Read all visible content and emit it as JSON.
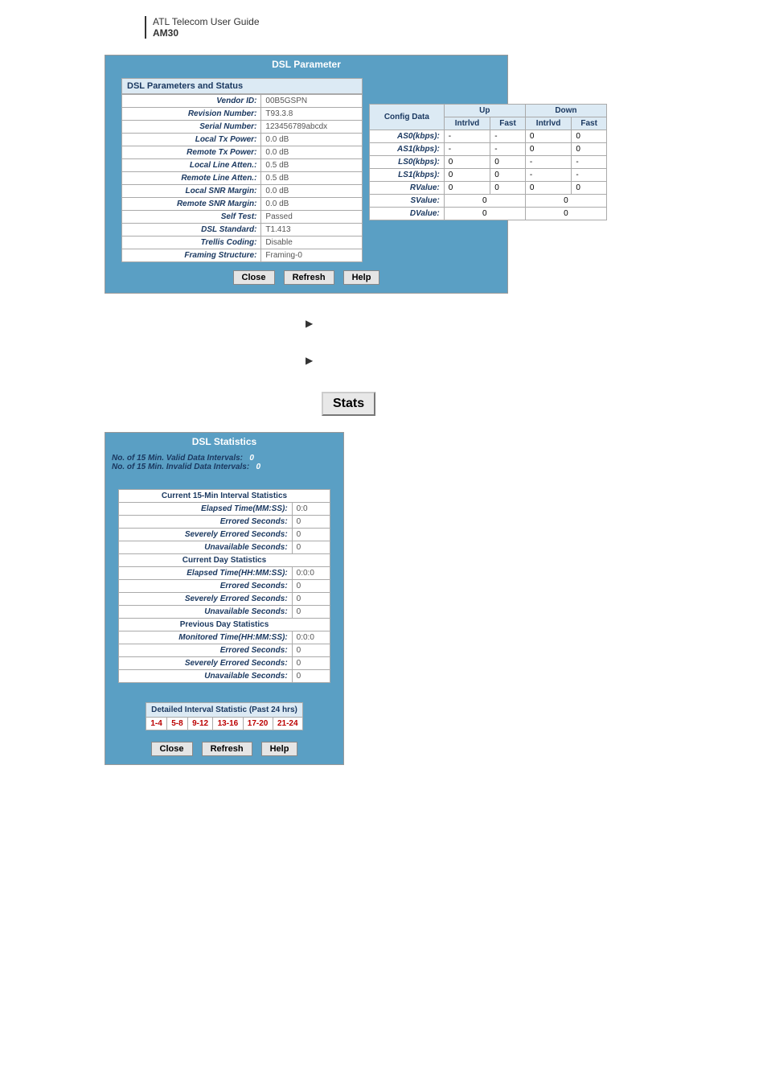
{
  "header": {
    "line1": "ATL Telecom User Guide",
    "line2": "AM30"
  },
  "dsl_param": {
    "title": "DSL Parameter",
    "section_header": "DSL Parameters and Status",
    "rows": [
      {
        "label": "Vendor ID:",
        "value": "00B5GSPN"
      },
      {
        "label": "Revision Number:",
        "value": "T93.3.8"
      },
      {
        "label": "Serial Number:",
        "value": "123456789abcdx"
      },
      {
        "label": "Local Tx Power:",
        "value": "0.0 dB"
      },
      {
        "label": "Remote Tx Power:",
        "value": "0.0 dB"
      },
      {
        "label": "Local Line Atten.:",
        "value": "0.5 dB"
      },
      {
        "label": "Remote Line Atten.:",
        "value": "0.5 dB"
      },
      {
        "label": "Local SNR Margin:",
        "value": "0.0 dB"
      },
      {
        "label": "Remote SNR Margin:",
        "value": "0.0 dB"
      },
      {
        "label": "Self Test:",
        "value": "Passed"
      },
      {
        "label": "DSL Standard:",
        "value": "T1.413"
      },
      {
        "label": "Trellis Coding:",
        "value": "Disable"
      },
      {
        "label": "Framing Structure:",
        "value": "Framing-0"
      }
    ],
    "config": {
      "header": "Config Data",
      "up": "Up",
      "down": "Down",
      "intrlvd": "Intrlvd",
      "fast": "Fast",
      "rows": [
        {
          "label": "AS0(kbps):",
          "ui": "-",
          "uf": "-",
          "di": "0",
          "df": "0"
        },
        {
          "label": "AS1(kbps):",
          "ui": "-",
          "uf": "-",
          "di": "0",
          "df": "0"
        },
        {
          "label": "LS0(kbps):",
          "ui": "0",
          "uf": "0",
          "di": "-",
          "df": "-"
        },
        {
          "label": "LS1(kbps):",
          "ui": "0",
          "uf": "0",
          "di": "-",
          "df": "-"
        },
        {
          "label": "RValue:",
          "ui": "0",
          "uf": "0",
          "di": "0",
          "df": "0"
        }
      ],
      "span_rows": [
        {
          "label": "SValue:",
          "up": "0",
          "down": "0"
        },
        {
          "label": "DValue:",
          "up": "0",
          "down": "0"
        }
      ]
    },
    "buttons": {
      "close": "Close",
      "refresh": "Refresh",
      "help": "Help"
    }
  },
  "instructions": {
    "line1": "",
    "line2": ""
  },
  "stats_button": "Stats",
  "dsl_stats": {
    "title": "DSL Statistics",
    "valid_label": "No. of 15 Min. Valid Data Intervals:",
    "valid_val": "0",
    "invalid_label": "No. of 15 Min. Invalid Data Intervals:",
    "invalid_val": "0",
    "sections": [
      {
        "header": "Current 15-Min Interval Statistics",
        "rows": [
          {
            "label": "Elapsed Time(MM:SS):",
            "value": "0:0"
          },
          {
            "label": "Errored Seconds:",
            "value": "0"
          },
          {
            "label": "Severely Errored Seconds:",
            "value": "0"
          },
          {
            "label": "Unavailable Seconds:",
            "value": "0"
          }
        ]
      },
      {
        "header": "Current Day Statistics",
        "rows": [
          {
            "label": "Elapsed Time(HH:MM:SS):",
            "value": "0:0:0"
          },
          {
            "label": "Errored Seconds:",
            "value": "0"
          },
          {
            "label": "Severely Errored Seconds:",
            "value": "0"
          },
          {
            "label": "Unavailable Seconds:",
            "value": "0"
          }
        ]
      },
      {
        "header": "Previous Day Statistics",
        "rows": [
          {
            "label": "Monitored Time(HH:MM:SS):",
            "value": "0:0:0"
          },
          {
            "label": "Errored Seconds:",
            "value": "0"
          },
          {
            "label": "Severely Errored Seconds:",
            "value": "0"
          },
          {
            "label": "Unavailable Seconds:",
            "value": "0"
          }
        ]
      }
    ],
    "detailed_header": "Detailed Interval Statistic (Past 24 hrs)",
    "intervals": [
      "1-4",
      "5-8",
      "9-12",
      "13-16",
      "17-20",
      "21-24"
    ],
    "buttons": {
      "close": "Close",
      "refresh": "Refresh",
      "help": "Help"
    }
  }
}
